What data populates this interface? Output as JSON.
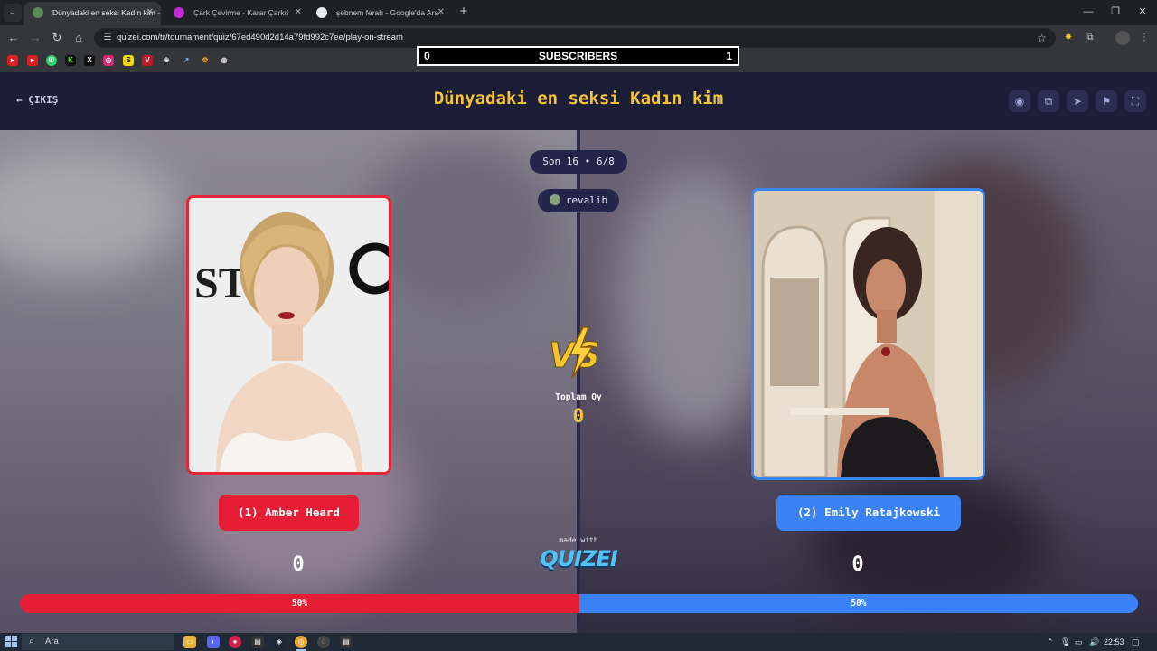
{
  "browser": {
    "tabs": [
      {
        "title": "Dünyadaki en seksi Kadın kim -",
        "active": true,
        "favicon_color": "#5d8a5a"
      },
      {
        "title": "Çark Çevirme - Karar Çarkı!",
        "active": false,
        "favicon_color": "#c42bd6"
      },
      {
        "title": "şebnem ferah - Google'da Ara",
        "active": false,
        "favicon_color": "#e8eaed"
      }
    ],
    "url": "quizei.com/tr/tournament/quiz/67ed490d2d14a79fd992c7ee/play-on-stream",
    "bookmark_icons": [
      "youtube-icon",
      "youtube-icon",
      "whatsapp-icon",
      "kick-icon",
      "x-icon",
      "instagram-icon",
      "s-icon",
      "vpn-icon",
      "chatgpt-icon",
      "chart-icon",
      "gear-icon",
      "globe-icon"
    ]
  },
  "overlay": {
    "left_count": "0",
    "label": "SUBSCRIBERS",
    "right_count": "1"
  },
  "page": {
    "exit_label": "ÇIKIŞ",
    "title": "Dünyadaki en seksi Kadın kim",
    "header_icons": [
      "eye-icon",
      "copy-icon",
      "send-icon",
      "flag-icon",
      "fullscreen-icon"
    ],
    "round_label": "Son 16 • 6/8",
    "username": "revalib",
    "total_votes_label": "Toplam Oy",
    "total_votes": "0",
    "made_with_label": "made with",
    "logo_text": "QUIZEI",
    "left": {
      "name": "(1) Amber Heard",
      "votes": "0",
      "percent_label": "50%",
      "percent": 50,
      "color": "#e71d36"
    },
    "right": {
      "name": "(2) Emily Ratajkowski",
      "votes": "0",
      "percent_label": "50%",
      "percent": 50,
      "color": "#3b82f6"
    }
  },
  "taskbar": {
    "search_placeholder": "Ara",
    "time": "22:53"
  }
}
